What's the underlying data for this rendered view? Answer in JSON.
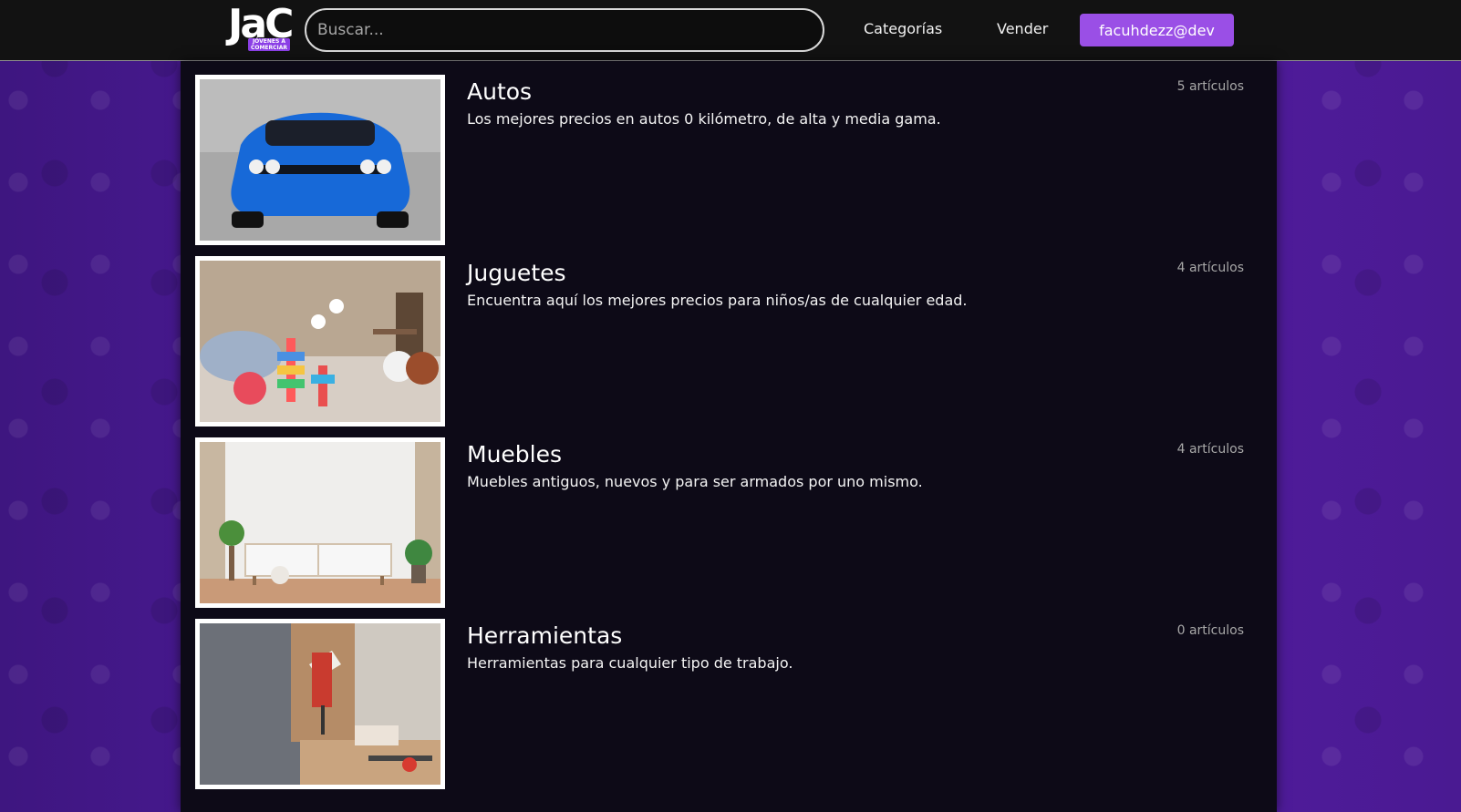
{
  "header": {
    "logo": {
      "letters": "JaC",
      "tagline": "JÓVENES A COMERCIAR"
    },
    "search": {
      "placeholder": "Buscar..."
    },
    "nav": {
      "categories": "Categorías",
      "sell": "Vender"
    },
    "user_button": "facuhdezz@dev"
  },
  "categories": [
    {
      "title": "Autos",
      "description": "Los mejores precios en autos 0 kilómetro, de alta y media gama.",
      "count": "5 artículos"
    },
    {
      "title": "Juguetes",
      "description": "Encuentra aquí los mejores precios para niños/as de cualquier edad.",
      "count": "4 artículos"
    },
    {
      "title": "Muebles",
      "description": "Muebles antiguos, nuevos y para ser armados por uno mismo.",
      "count": "4 artículos"
    },
    {
      "title": "Herramientas",
      "description": "Herramientas para cualquier tipo de trabajo.",
      "count": "0 artículos"
    }
  ],
  "colors": {
    "topbar": "#121212",
    "accent": "#9a4fe6",
    "background_purple": "#4c1a93",
    "panel": "#0d0a17"
  }
}
